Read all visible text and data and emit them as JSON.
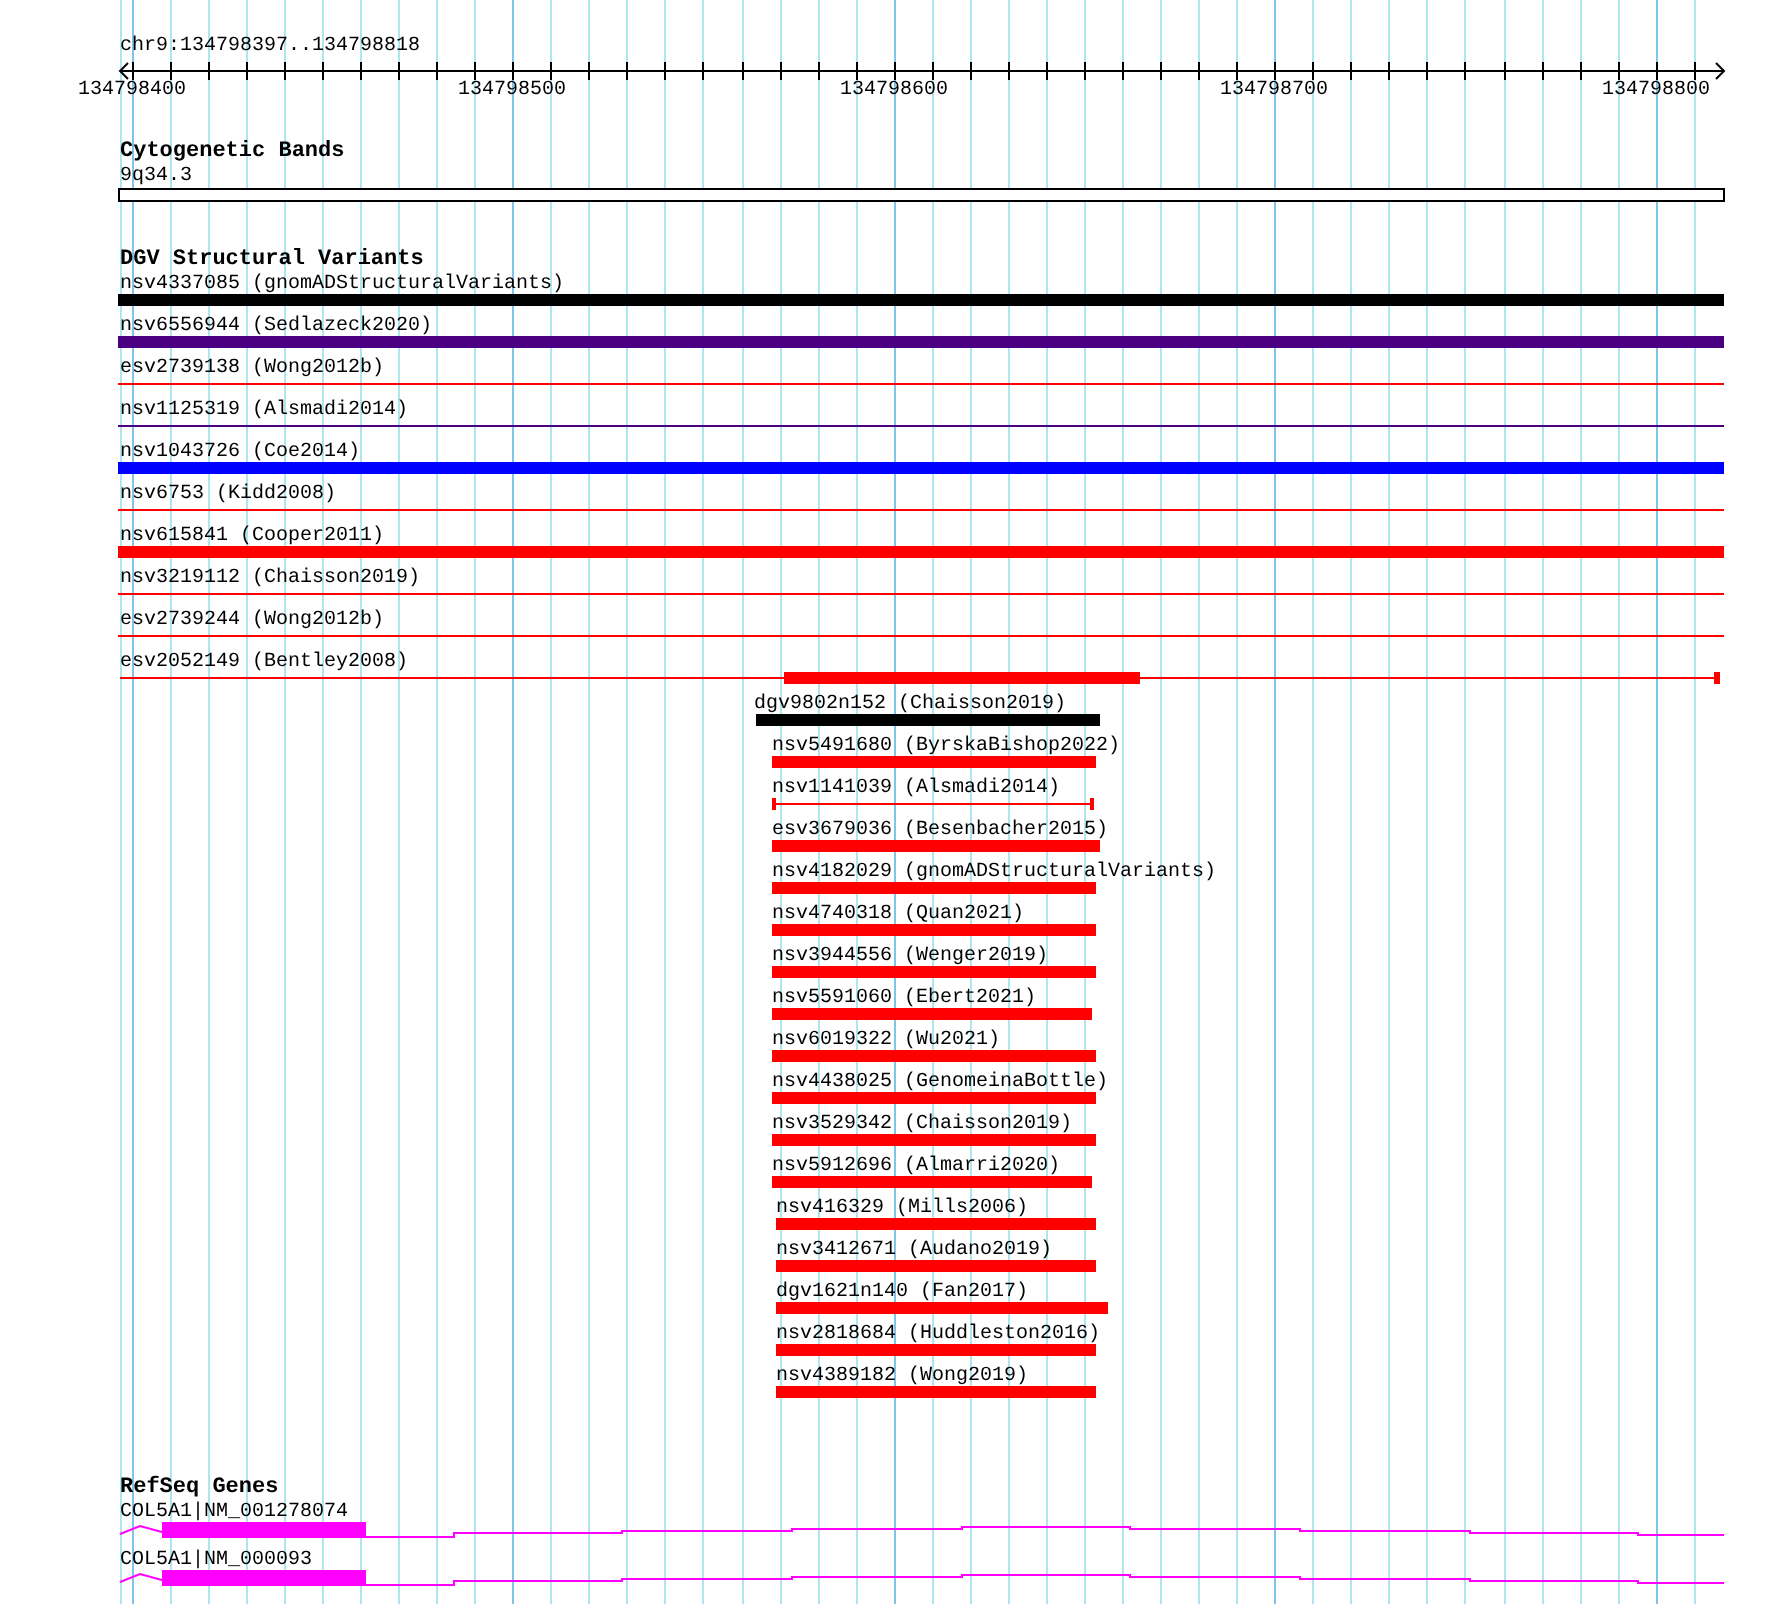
{
  "location": "chr9:134798397..134798818",
  "ruler": {
    "ticks": [
      "134798400",
      "134798500",
      "134798600",
      "134798700",
      "134798800"
    ]
  },
  "tracks": [
    {
      "title": "Cytogenetic Bands",
      "kind": "bands",
      "features": [
        {
          "label": "9q34.3"
        }
      ]
    },
    {
      "title": "DGV Structural Variants",
      "kind": "variants",
      "features": [
        {
          "label": "nsv4337085 (gnomADStructuralVariants)",
          "kind": "thick",
          "color": "#000000"
        },
        {
          "label": "nsv6556944 (Sedlazeck2020)",
          "kind": "thick",
          "color": "#4b0082"
        },
        {
          "label": "esv2739138 (Wong2012b)",
          "kind": "thin",
          "color": "#ff0000"
        },
        {
          "label": "nsv1125319 (Alsmadi2014)",
          "kind": "thin",
          "color": "#4b0082"
        },
        {
          "label": "nsv1043726 (Coe2014)",
          "kind": "thick",
          "color": "#0000ff"
        },
        {
          "label": "nsv6753 (Kidd2008)",
          "kind": "thin",
          "color": "#ff0000"
        },
        {
          "label": "nsv615841 (Cooper2011)",
          "kind": "thick",
          "color": "#ff0000"
        },
        {
          "label": "nsv3219112 (Chaisson2019)",
          "kind": "thin",
          "color": "#ff0000"
        },
        {
          "label": "esv2739244 (Wong2012b)",
          "kind": "thin",
          "color": "#ff0000"
        },
        {
          "label": "esv2052149 (Bentley2008)",
          "kind": "segmented",
          "color": "#ff0000"
        },
        {
          "label": "dgv9802n152 (Chaisson2019)",
          "kind": "thick",
          "color": "#000000"
        },
        {
          "label": "nsv5491680 (ByrskaBishop2022)",
          "kind": "thick",
          "color": "#ff0000"
        },
        {
          "label": "nsv1141039 (Alsmadi2014)",
          "kind": "capped",
          "color": "#ff0000"
        },
        {
          "label": "esv3679036 (Besenbacher2015)",
          "kind": "thick",
          "color": "#ff0000"
        },
        {
          "label": "nsv4182029 (gnomADStructuralVariants)",
          "kind": "thick",
          "color": "#ff0000"
        },
        {
          "label": "nsv4740318 (Quan2021)",
          "kind": "thick",
          "color": "#ff0000"
        },
        {
          "label": "nsv3944556 (Wenger2019)",
          "kind": "thick",
          "color": "#ff0000"
        },
        {
          "label": "nsv5591060 (Ebert2021)",
          "kind": "thick",
          "color": "#ff0000"
        },
        {
          "label": "nsv6019322 (Wu2021)",
          "kind": "thick",
          "color": "#ff0000"
        },
        {
          "label": "nsv4438025 (GenomeinaBottle)",
          "kind": "thick",
          "color": "#ff0000"
        },
        {
          "label": "nsv3529342 (Chaisson2019)",
          "kind": "thick",
          "color": "#ff0000"
        },
        {
          "label": "nsv5912696 (Almarri2020)",
          "kind": "thick",
          "color": "#ff0000"
        },
        {
          "label": "nsv416329 (Mills2006)",
          "kind": "thick",
          "color": "#ff0000"
        },
        {
          "label": "nsv3412671 (Audano2019)",
          "kind": "thick",
          "color": "#ff0000"
        },
        {
          "label": "dgv1621n140 (Fan2017)",
          "kind": "thick",
          "color": "#ff0000"
        },
        {
          "label": "nsv2818684 (Huddleston2016)",
          "kind": "thick",
          "color": "#ff0000"
        },
        {
          "label": "nsv4389182 (Wong2019)",
          "kind": "thick",
          "color": "#ff0000"
        }
      ]
    },
    {
      "title": "RefSeq Genes",
      "kind": "genes",
      "features": [
        {
          "label": "COL5A1|NM_001278074"
        },
        {
          "label": "COL5A1|NM_000093"
        }
      ]
    }
  ]
}
